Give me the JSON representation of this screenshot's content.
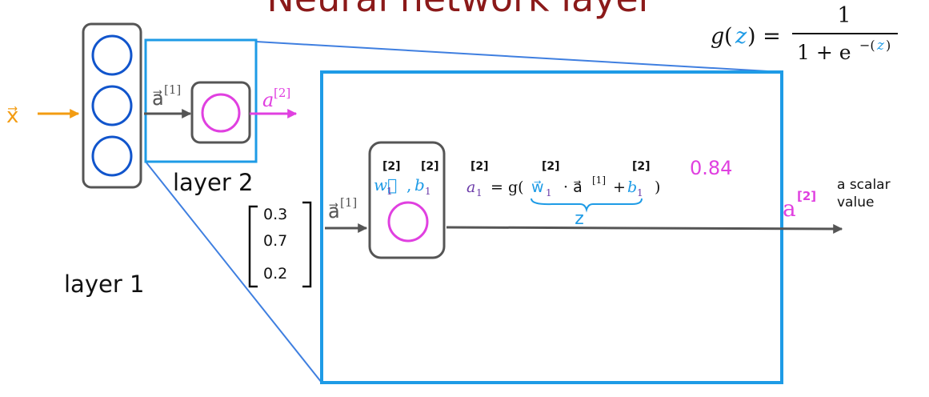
{
  "title": "Neural network layer",
  "sigmoid": {
    "lhs_g": "g",
    "lhs_open": "(",
    "lhs_z": "z",
    "lhs_close": ") =",
    "numerator": "1",
    "denominator_base": "1 + e",
    "denominator_exp_pre": "−(",
    "denominator_exp_z": "z",
    "denominator_exp_post": ")"
  },
  "input": {
    "x_label": "x⃗"
  },
  "layer1": {
    "label": "layer 1"
  },
  "layer2": {
    "label": "layer 2",
    "input_label": "a⃗",
    "input_sup": "[1]",
    "output_label": "a",
    "output_sup": "[2]"
  },
  "zoom": {
    "input_vector": [
      "0.3",
      "0.7",
      "0.2"
    ],
    "input_label": "a⃗",
    "input_sup": "[1]",
    "w_label": "w⃗",
    "w_sub": "1",
    "w_sup": "[2]",
    "comma": ",",
    "b_label": "b",
    "b_sub": "1",
    "b_sup": "[2]",
    "eq_a": "a",
    "eq_a_sub": "1",
    "eq_a_sup": "[2]",
    "eq_mid": "= g(",
    "eq_w": "w⃗",
    "eq_w_sub": "1",
    "eq_w_sup": "[2]",
    "eq_dot": "· a⃗",
    "eq_dot_sup": "[1]",
    "eq_plus": "+",
    "eq_b": "b",
    "eq_b_sub": "1",
    "eq_b_sup": "[2]",
    "eq_close": ")",
    "brace_label": "z",
    "output_value": "0.84",
    "output_label": "a",
    "output_sup": "[2]",
    "scalar_note_1": "a scalar",
    "scalar_note_2": "value"
  },
  "colors": {
    "title": "#8b1a1a",
    "box_blue": "#1e9be6",
    "light_blue": "#3f7fe0",
    "neuron_blue": "#1155cc",
    "magenta": "#e040e0",
    "orange": "#f39c12",
    "purple": "#6a3aa8",
    "gray": "#555555"
  }
}
